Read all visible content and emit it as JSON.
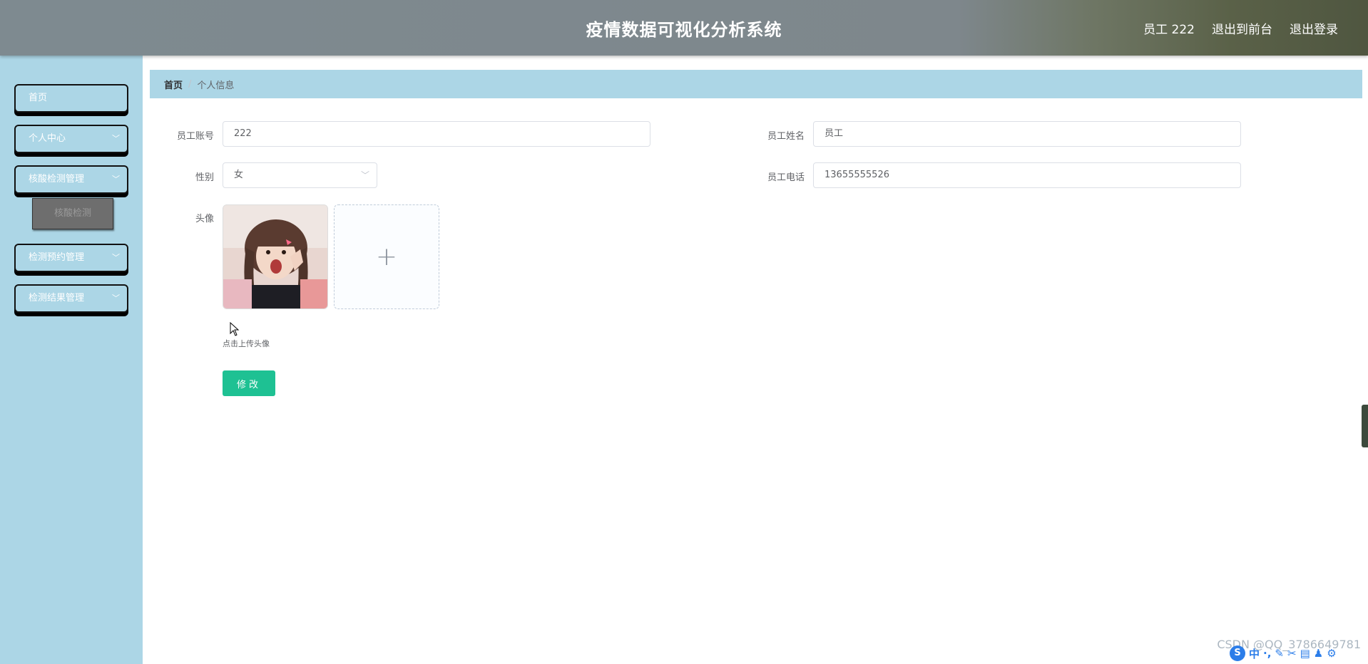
{
  "header": {
    "title": "疫情数据可视化分析系统",
    "user": "员工 222",
    "to_front": "退出到前台",
    "logout": "退出登录"
  },
  "sidebar": {
    "items": [
      {
        "label": "首页"
      },
      {
        "label": "个人中心"
      },
      {
        "label": "核酸检测管理"
      },
      {
        "label": "检测预约管理"
      },
      {
        "label": "检测结果管理"
      }
    ],
    "submenu": {
      "label": "核酸检测"
    }
  },
  "breadcrumb": {
    "home": "首页",
    "current": "个人信息"
  },
  "form": {
    "account_label": "员工账号",
    "account_value": "222",
    "name_label": "员工姓名",
    "name_value": "员工",
    "gender_label": "性别",
    "gender_value": "女",
    "phone_label": "员工电话",
    "phone_value": "13655555526",
    "avatar_label": "头像",
    "upload_tip": "点击上传头像",
    "submit_label": "修改"
  },
  "overlay": {
    "watermark": "CSDN @QQ_3786649781",
    "ime_chars": [
      "中",
      "·,",
      "✎",
      "✂",
      "▤",
      "♟",
      "⚙"
    ]
  },
  "colors": {
    "sidebar_bg": "#acd6e6",
    "header_bg": "#7e8a90",
    "accent": "#1ec193"
  }
}
